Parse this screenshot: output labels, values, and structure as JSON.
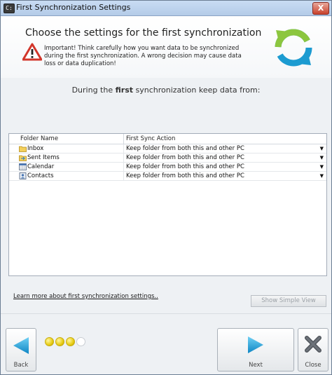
{
  "window": {
    "title": "First Synchronization Settings",
    "app_icon_text": "C:",
    "close_symbol": "X"
  },
  "header": {
    "heading": "Choose the settings for the first synchronization",
    "warning": "Important! Think carefully how you want data to be synchronized during the first synchronization. A wrong decision may cause data loss or data duplication!"
  },
  "subtitle": {
    "before": "During the ",
    "emphasis": "first",
    "after": " synchronization keep data from:"
  },
  "grid": {
    "columns": [
      "Folder Name",
      "First Sync Action"
    ],
    "rows": [
      {
        "icon": "inbox-folder-icon",
        "name": "Inbox",
        "action": "Keep folder from both this and other PC"
      },
      {
        "icon": "sent-items-folder-icon",
        "name": "Sent Items",
        "action": "Keep folder from both this and other PC"
      },
      {
        "icon": "calendar-icon",
        "name": "Calendar",
        "action": "Keep folder from both this and other PC"
      },
      {
        "icon": "contacts-icon",
        "name": "Contacts",
        "action": "Keep folder from both this and other PC"
      }
    ]
  },
  "links": {
    "learn_more": "Learn more about first synchronization settings.."
  },
  "buttons": {
    "show_simple_view": "Show Simple View",
    "back": "Back",
    "next": "Next",
    "close": "Close"
  },
  "progress": {
    "total_steps": 4,
    "completed_steps": 3
  },
  "colors": {
    "accent_blue": "#1c9bd1",
    "logo_green": "#8cc63f",
    "warning_red": "#d2362b",
    "dot_yellow": "#e7cc13"
  }
}
